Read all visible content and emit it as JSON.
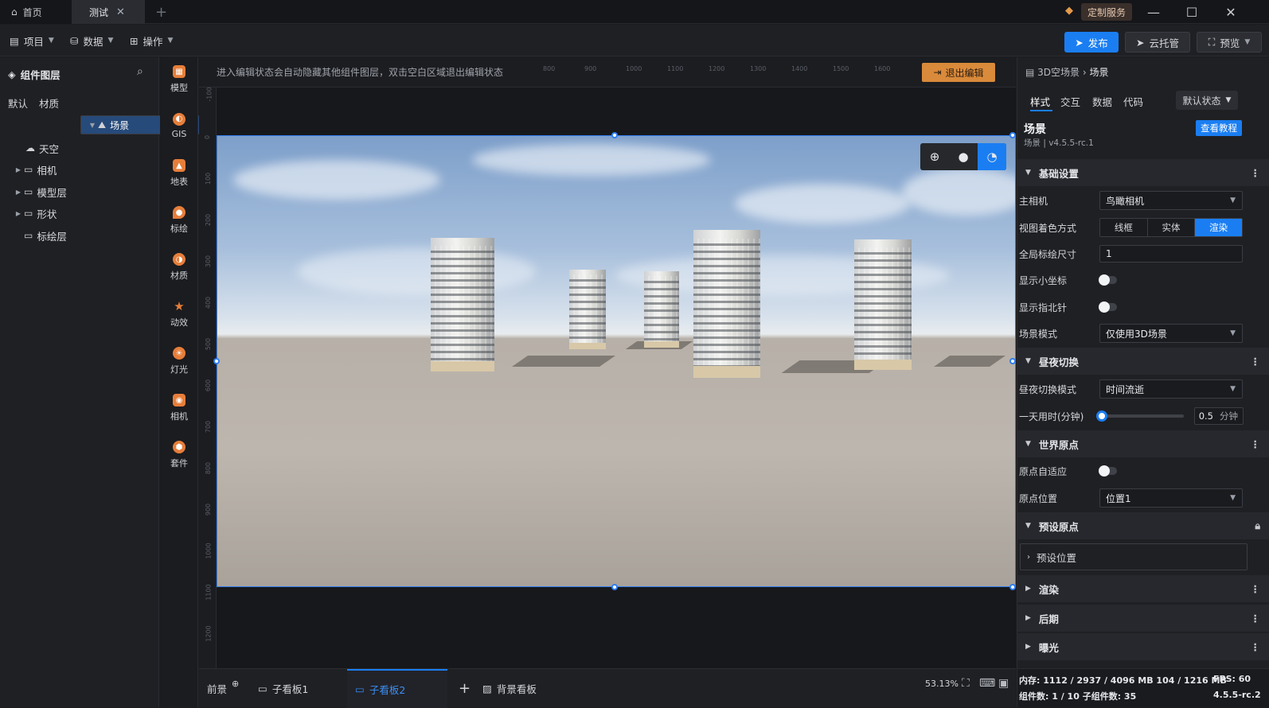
{
  "titlebar": {
    "tabs": [
      {
        "label": "首页"
      },
      {
        "label": "测试"
      }
    ],
    "custom_service": "定制服务"
  },
  "menubar": {
    "items": [
      {
        "label": "项目"
      },
      {
        "label": "数据"
      },
      {
        "label": "操作"
      }
    ],
    "publish": "发布",
    "cloud_host": "云托管",
    "preview": "预览"
  },
  "layers": {
    "title": "组件图层",
    "tabs": [
      "默认",
      "材质"
    ],
    "tree": [
      {
        "label": "场景"
      },
      {
        "label": "天空"
      },
      {
        "label": "相机"
      },
      {
        "label": "模型层"
      },
      {
        "label": "形状"
      },
      {
        "label": "标绘层"
      }
    ]
  },
  "tools": [
    {
      "label": "模型"
    },
    {
      "label": "GIS"
    },
    {
      "label": "地表"
    },
    {
      "label": "标绘"
    },
    {
      "label": "材质"
    },
    {
      "label": "动效"
    },
    {
      "label": "灯光"
    },
    {
      "label": "相机"
    },
    {
      "label": "套件"
    }
  ],
  "canvas": {
    "notice": "进入编辑状态会自动隐藏其他组件图层，双击空白区域退出编辑状态",
    "exit_edit": "退出编辑",
    "ruler_top": [
      "800",
      "900",
      "1000",
      "1100",
      "1200",
      "1300",
      "1400",
      "1500",
      "1600"
    ],
    "ruler_left": [
      "-100",
      "0",
      "100",
      "200",
      "300",
      "400",
      "500",
      "600",
      "700",
      "800",
      "900",
      "1000",
      "1100",
      "1200"
    ]
  },
  "bottombar": {
    "tabs": [
      {
        "label": "前景"
      },
      {
        "label": "子看板1"
      },
      {
        "label": "子看板2"
      },
      {
        "label": "背景看板"
      }
    ],
    "zoom": "53.13%"
  },
  "inspector": {
    "breadcrumb_parent": "3D空场景",
    "breadcrumb_current": "场景",
    "tabs": [
      "样式",
      "交互",
      "数据",
      "代码"
    ],
    "state": "默认状态",
    "component_name": "场景",
    "component_version": "场景 | v4.5.5-rc.1",
    "tutorial": "查看教程",
    "sections": {
      "basic": "基础设置",
      "daynight": "昼夜切换",
      "origin": "世界原点",
      "preset_origin": "预设原点",
      "render": "渲染",
      "post": "后期",
      "exposure": "曝光"
    },
    "main_camera_label": "主相机",
    "main_camera_value": "鸟瞰相机",
    "shading_label": "视图着色方式",
    "shading_options": [
      "线框",
      "实体",
      "渲染"
    ],
    "marker_size_label": "全局标绘尺寸",
    "marker_size_value": "1",
    "show_axes_label": "显示小坐标",
    "show_compass_label": "显示指北针",
    "scene_mode_label": "场景模式",
    "scene_mode_value": "仅使用3D场景",
    "daynight_mode_label": "昼夜切换模式",
    "daynight_mode_value": "时间流逝",
    "day_duration_label": "一天用时(分钟)",
    "day_duration_value": "0.5",
    "day_duration_unit": "分钟",
    "origin_adapt_label": "原点自适应",
    "origin_pos_label": "原点位置",
    "origin_pos_value": "位置1",
    "preset_position": "预设位置"
  },
  "stats": {
    "memory": "内存:  1112 / 2937 / 4096 MB  104 / 1216 MB",
    "fps": "FPS:  60",
    "components": "组件数: 1 / 10    子组件数: 35",
    "version": "4.5.5-rc.2"
  },
  "colors": {
    "accent": "#1a7ef2",
    "exit": "#d98a3a",
    "selected": "#264a7a"
  }
}
